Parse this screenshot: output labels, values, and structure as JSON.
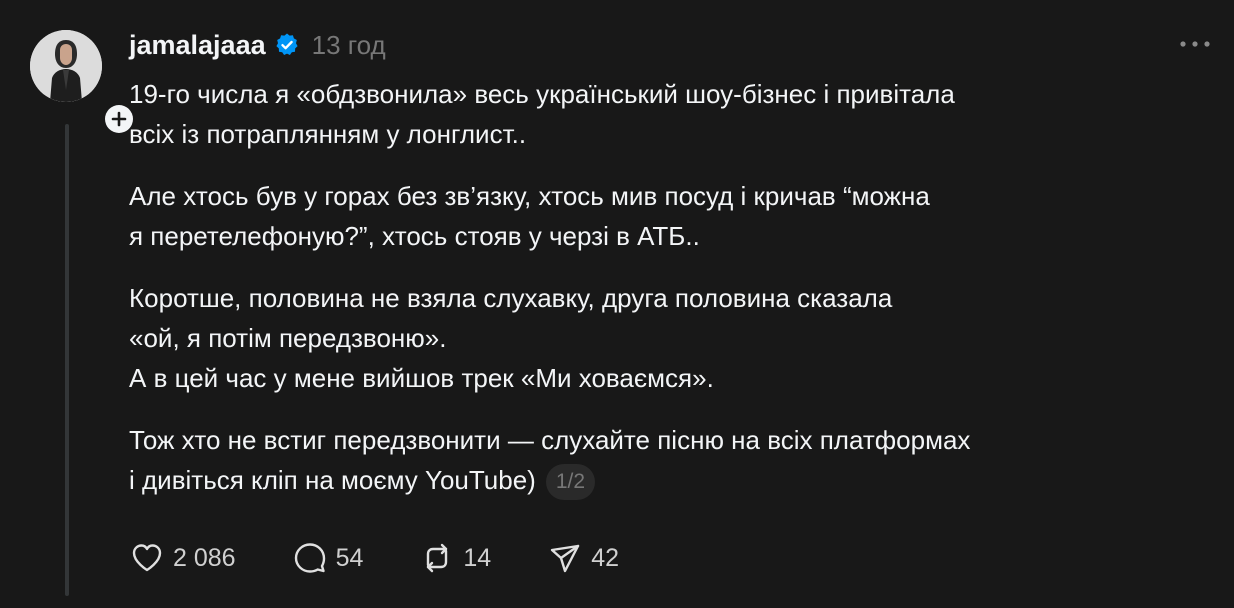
{
  "post": {
    "username": "jamalajaaa",
    "time": "13 год",
    "paragraphs": [
      {
        "lines": [
          "19-го числа я «обдзвонила» весь український шоу-бізнес і привітала",
          "всіх із потраплянням у лонглист.."
        ]
      },
      {
        "lines": [
          "Але хтось був у горах без зв’язку, хтось мив посуд і кричав “можна",
          "я перетелефоную?”, хтось стояв у черзі в АТБ.."
        ]
      },
      {
        "lines": [
          "Коротше, половина не взяла слухавку, друга половина сказала",
          "«ой, я потім передзвоню».",
          "А в цей час у мене вийшов трек «Ми ховаємся»."
        ]
      },
      {
        "lines": [
          "Тож хто не встиг передзвонити — слухайте пісню на всіх платформах",
          "і дивіться кліп на моєму YouTube)"
        ]
      }
    ],
    "page_indicator": "1/2"
  },
  "actions": {
    "likes": "2 086",
    "comments": "54",
    "reposts": "14",
    "shares": "42"
  },
  "icons": {
    "verified": "verified-badge-icon",
    "follow": "plus-icon",
    "more": "more-dots-icon",
    "like": "heart-icon",
    "comment": "comment-icon",
    "repost": "repost-icon",
    "share": "share-icon"
  },
  "colors": {
    "background": "#181818",
    "text": "#f3f5f7",
    "muted": "#777777",
    "verified": "#0095f6"
  }
}
